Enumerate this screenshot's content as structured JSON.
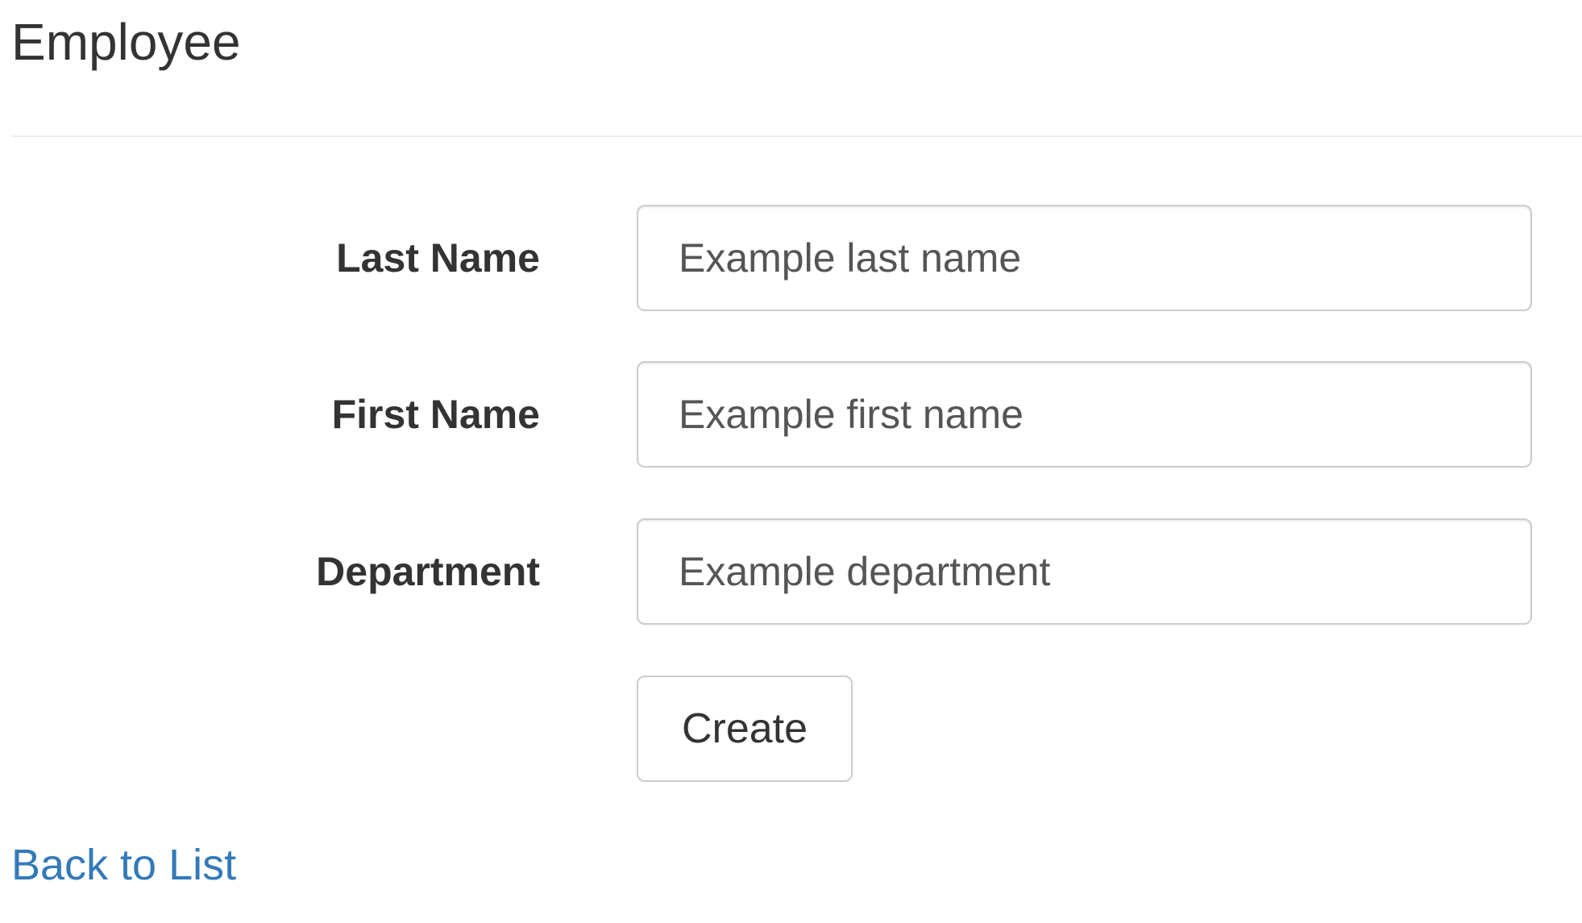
{
  "page": {
    "title": "Employee"
  },
  "form": {
    "fields": [
      {
        "label": "Last Name",
        "value": "",
        "placeholder": "Example last name"
      },
      {
        "label": "First Name",
        "value": "",
        "placeholder": "Example first name"
      },
      {
        "label": "Department",
        "value": "",
        "placeholder": "Example department"
      }
    ],
    "submit_label": "Create"
  },
  "footer": {
    "back_link_label": "Back to List"
  },
  "colors": {
    "link": "#337ab7",
    "text": "#333333",
    "input_border": "#cccccc",
    "divider": "#eeeeee"
  }
}
